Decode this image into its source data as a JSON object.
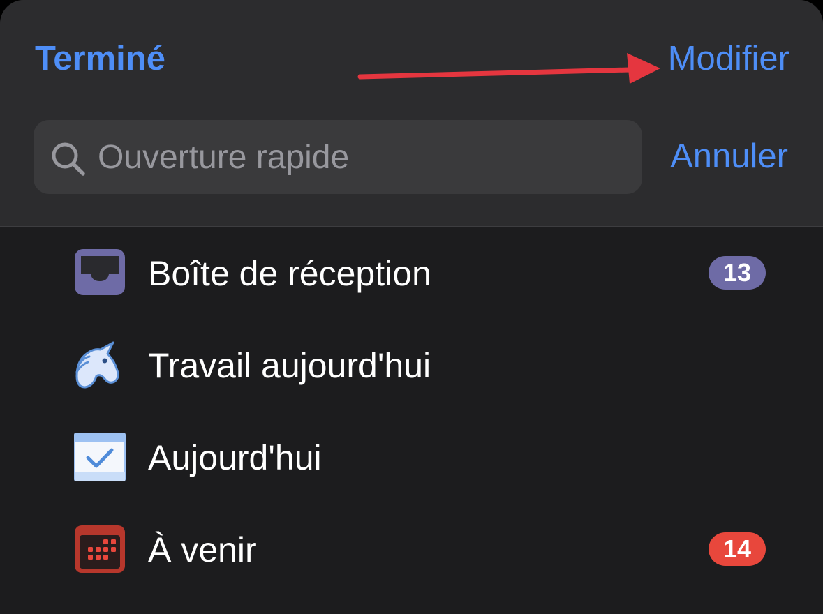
{
  "header": {
    "done_label": "Terminé",
    "edit_label": "Modifier"
  },
  "search": {
    "placeholder": "Ouverture rapide",
    "value": "",
    "cancel_label": "Annuler"
  },
  "colors": {
    "accent": "#4e8ef7",
    "annotation_arrow": "#e5363f",
    "badge_inbox": "#6e6ba6",
    "badge_upcoming": "#e8473c"
  },
  "list": {
    "items": [
      {
        "label": "Boîte de réception",
        "icon": "inbox-tray-icon",
        "badge": "13"
      },
      {
        "label": "Travail aujourd'hui",
        "icon": "unicorn-icon",
        "badge": ""
      },
      {
        "label": "Aujourd'hui",
        "icon": "calendar-check-icon",
        "badge": ""
      },
      {
        "label": "À venir",
        "icon": "calendar-grid-icon",
        "badge": "14"
      }
    ]
  }
}
